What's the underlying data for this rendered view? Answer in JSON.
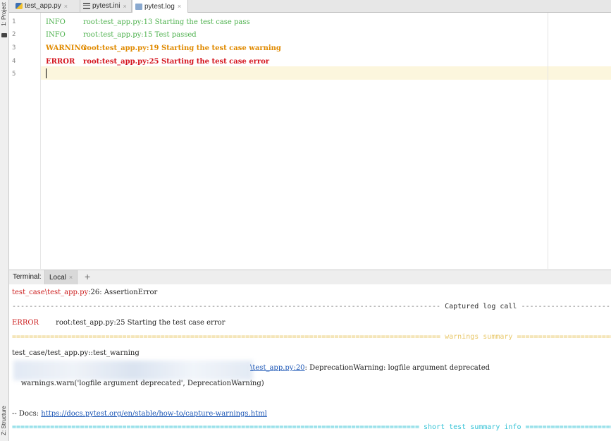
{
  "sidebar": {
    "project_label": "1: Project",
    "structure_label": "Z: Structure"
  },
  "tabs": [
    {
      "label": "test_app.py",
      "icon": "python-file-icon",
      "active": false
    },
    {
      "label": "pytest.ini",
      "icon": "ini-file-icon",
      "active": false
    },
    {
      "label": "pytest.log",
      "icon": "log-file-icon",
      "active": true
    }
  ],
  "editor": {
    "lines": [
      {
        "num": "1",
        "level": "INFO",
        "message": "root:test_app.py:13 Starting the test case pass"
      },
      {
        "num": "2",
        "level": "INFO",
        "message": "root:test_app.py:15 Test passed"
      },
      {
        "num": "3",
        "level": "WARNING",
        "message": "root:test_app.py:19 Starting the test case warning"
      },
      {
        "num": "4",
        "level": "ERROR",
        "message": "root:test_app.py:25 Starting the test case error"
      },
      {
        "num": "5",
        "level": "",
        "message": ""
      }
    ]
  },
  "terminal": {
    "title": "Terminal:",
    "tab_label": "Local",
    "add_label": "+",
    "assertion_path": "test_case\\test_app.py",
    "assertion_rest": ":26: AssertionError",
    "captured_log_title": " Captured log call ",
    "captured_level": "ERROR",
    "captured_message": "root:test_app.py:25 Starting the test case error",
    "warnings_title": " warnings summary ",
    "warning_test": "test_case/test_app.py::test_warning",
    "warning_link": "\\test_app.py",
    "warning_line": ":20",
    "warning_text": ": DeprecationWarning: logfile argument deprecated",
    "warning_code": "    warnings.warn('logfile argument deprecated', DeprecationWarning)",
    "docs_prefix": "-- Docs: ",
    "docs_url": "https://docs.pytest.org/en/stable/how-to/capture-warnings.html",
    "summary_title": " short test summary info "
  },
  "colors": {
    "info": "#4fb24f",
    "warning": "#e08a00",
    "error": "#d4141e",
    "current_line": "#fcf6dd",
    "link": "#1a55b5"
  }
}
